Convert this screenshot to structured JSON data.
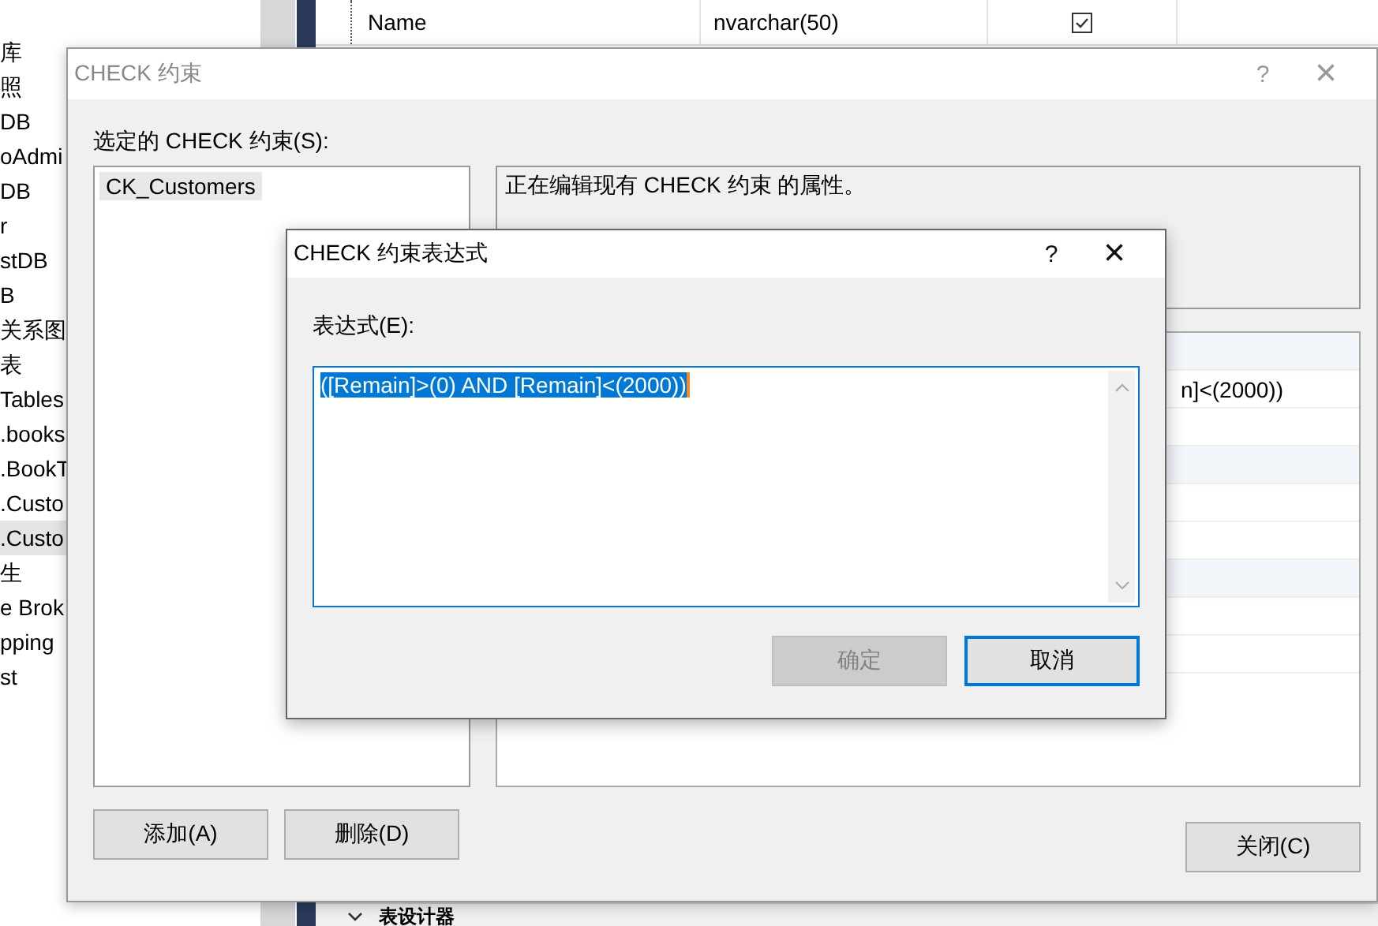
{
  "explorer": {
    "items": [
      {
        "label": "库",
        "selected": false
      },
      {
        "label": "照",
        "selected": false
      },
      {
        "label": "DB",
        "selected": false
      },
      {
        "label": "oAdmi",
        "selected": false
      },
      {
        "label": "DB",
        "selected": false
      },
      {
        "label": "r",
        "selected": false
      },
      {
        "label": "stDB",
        "selected": false
      },
      {
        "label": "B",
        "selected": false
      },
      {
        "label": "关系图",
        "selected": false
      },
      {
        "label": "表",
        "selected": false
      },
      {
        "label": "Tables",
        "selected": false
      },
      {
        "label": ".books",
        "selected": false
      },
      {
        "label": ".BookT",
        "selected": false
      },
      {
        "label": ".Custo",
        "selected": false
      },
      {
        "label": ".Custo",
        "selected": true
      },
      {
        "label": "生",
        "selected": false
      },
      {
        "label": "e Brok",
        "selected": false
      },
      {
        "label": "pping",
        "selected": false
      },
      {
        "label": "st",
        "selected": false
      }
    ]
  },
  "columns_grid": {
    "row": {
      "name": "Name",
      "type": "nvarchar(50)",
      "allow_nulls": true
    }
  },
  "bottom_panel": {
    "title": "表设计器"
  },
  "check_dialog": {
    "title": "CHECK 约束",
    "help": "?",
    "close": "×",
    "list_label": "选定的 CHECK 约束(S):",
    "constraints": [
      {
        "label": "CK_Customers",
        "selected": true
      }
    ],
    "description": "正在编辑现有 CHECK 约束 的属性。",
    "property_grid": {
      "visible_text": "n]<(2000))"
    },
    "buttons": [
      {
        "label": "添加(A)",
        "kind": "add"
      },
      {
        "label": "删除(D)",
        "kind": "delete"
      },
      {
        "label": "关闭(C)",
        "kind": "close"
      }
    ]
  },
  "expression_dialog": {
    "title": "CHECK 约束表达式",
    "help": "?",
    "close": "×",
    "label": "表达式(E):",
    "value": "([Remain]>(0) AND [Remain]<(2000))",
    "buttons": [
      {
        "label": "确定",
        "disabled": true,
        "default": false
      },
      {
        "label": "取消",
        "disabled": false,
        "default": true
      }
    ]
  }
}
